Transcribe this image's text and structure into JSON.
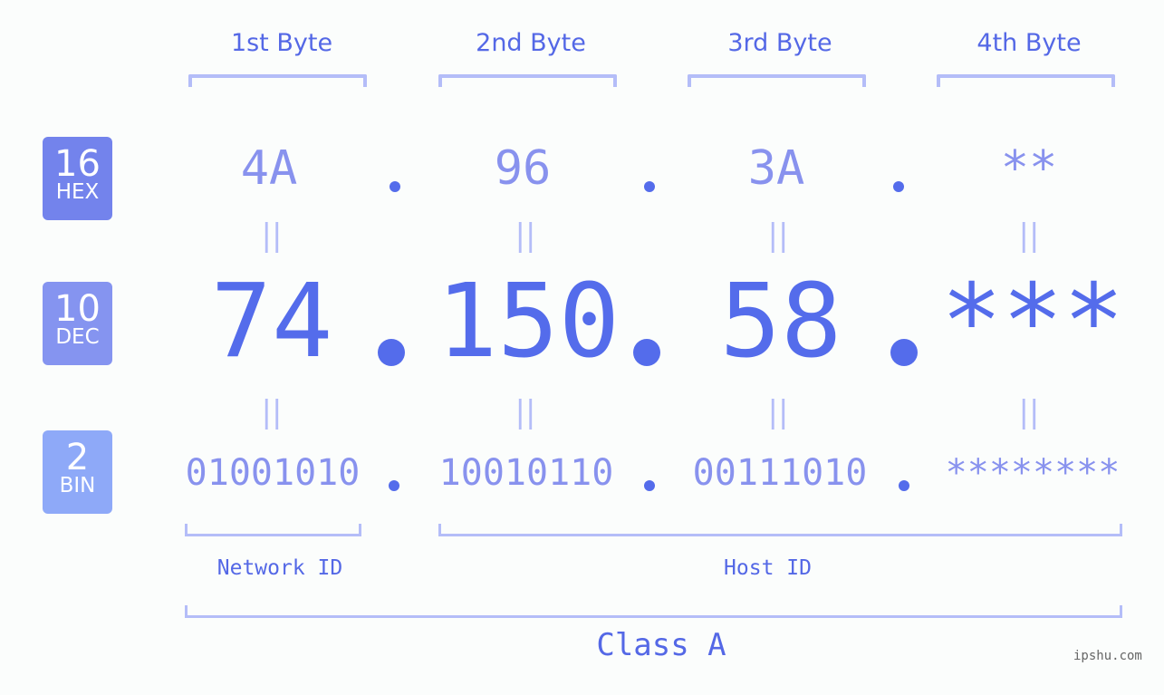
{
  "byte_headers": [
    "1st Byte",
    "2nd Byte",
    "3rd Byte",
    "4th Byte"
  ],
  "badges": {
    "hex": {
      "number": "16",
      "label": "HEX",
      "color": "#7383ec"
    },
    "dec": {
      "number": "10",
      "label": "DEC",
      "color": "#8594f0"
    },
    "bin": {
      "number": "2",
      "label": "BIN",
      "color": "#8ea9f8"
    }
  },
  "hex": [
    "4A",
    "96",
    "3A",
    "**"
  ],
  "dec": [
    "74",
    "150",
    "58",
    "***"
  ],
  "bin": [
    "01001010",
    "10010110",
    "00111010",
    "********"
  ],
  "equals_symbol": "||",
  "network_id_label": "Network ID",
  "host_id_label": "Host ID",
  "class_label": "Class A",
  "watermark": "ipshu.com",
  "colors": {
    "accent": "#546ceb",
    "light_value": "#8892ee",
    "bracket": "#b4bdf8",
    "background": "#fbfdfc"
  }
}
